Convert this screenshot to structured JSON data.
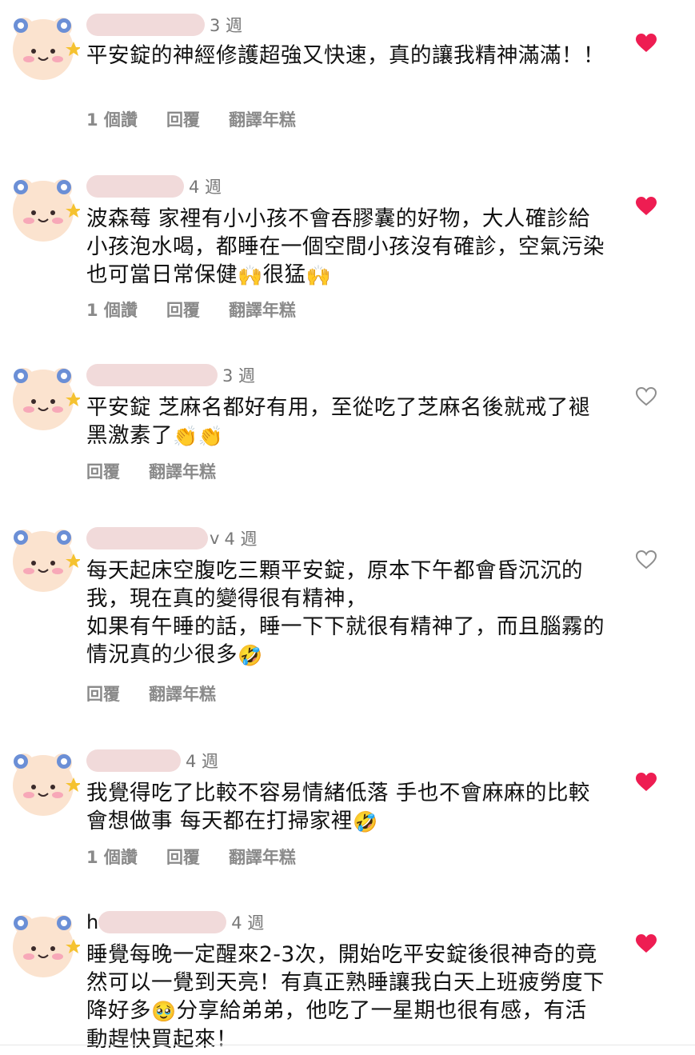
{
  "colors": {
    "liked_heart": "#ee1d52",
    "unliked_heart": "#8e8e8e",
    "name_blur": "#f1dada"
  },
  "comments": [
    {
      "time": "3 週",
      "name_prefix": "",
      "text": "平安錠的神經修護超強又快速，真的讓我精神滿滿！！",
      "likes": "1 個讚",
      "reply": "回覆",
      "translate": "翻譯年糕",
      "liked": true,
      "heart_icon": "heart-filled-icon"
    },
    {
      "time": "4 週",
      "name_prefix": "",
      "text_part1": "波森莓 家裡有小小孩不會吞膠囊的好物，大人確診給小孩泡水喝，都睡在一個空間小孩沒有確診，空氣污染也可當日常保健",
      "emoji1": "🙌",
      "text_part2": "很猛",
      "emoji2": "🙌",
      "likes": "1 個讚",
      "reply": "回覆",
      "translate": "翻譯年糕",
      "liked": true,
      "heart_icon": "heart-filled-icon"
    },
    {
      "time": "3 週",
      "name_prefix": "",
      "text_part1": "平安錠 芝麻名都好有用，至從吃了芝麻名後就戒了褪黑激素了",
      "emoji1": "👏",
      "emoji2": "👏",
      "reply": "回覆",
      "translate": "翻譯年糕",
      "liked": false,
      "heart_icon": "heart-outline-icon"
    },
    {
      "time": "4 週",
      "name_prefix": "",
      "name_suffix": "v",
      "text_line1": "每天起床空腹吃三顆平安錠，原本下午都會昏沉沉的我，現在真的變得很有精神，",
      "text_line2": "如果有午睡的話，睡一下下就很有精神了，而且腦霧的情況真的少很多",
      "emoji1": "🤣",
      "reply": "回覆",
      "translate": "翻譯年糕",
      "liked": false,
      "heart_icon": "heart-outline-icon"
    },
    {
      "time": "4 週",
      "name_prefix": "",
      "text_part1": "我覺得吃了比較不容易情緒低落 手也不會麻麻的比較會想做事 每天都在打掃家裡",
      "emoji1": "🤣",
      "likes": "1 個讚",
      "reply": "回覆",
      "translate": "翻譯年糕",
      "liked": true,
      "heart_icon": "heart-filled-icon"
    },
    {
      "time": "4 週",
      "name_prefix": "h",
      "text_part1": "睡覺每晚一定醒來2-3次，開始吃平安錠後很神奇的竟然可以一覺到天亮！有真正熟睡讓我白天上班疲勞度下降好多",
      "emoji1": "🥹",
      "text_part2": "分享給弟弟，他吃了一星期也很有感，有活動趕快買起來！",
      "liked": true,
      "heart_icon": "heart-filled-icon"
    }
  ]
}
